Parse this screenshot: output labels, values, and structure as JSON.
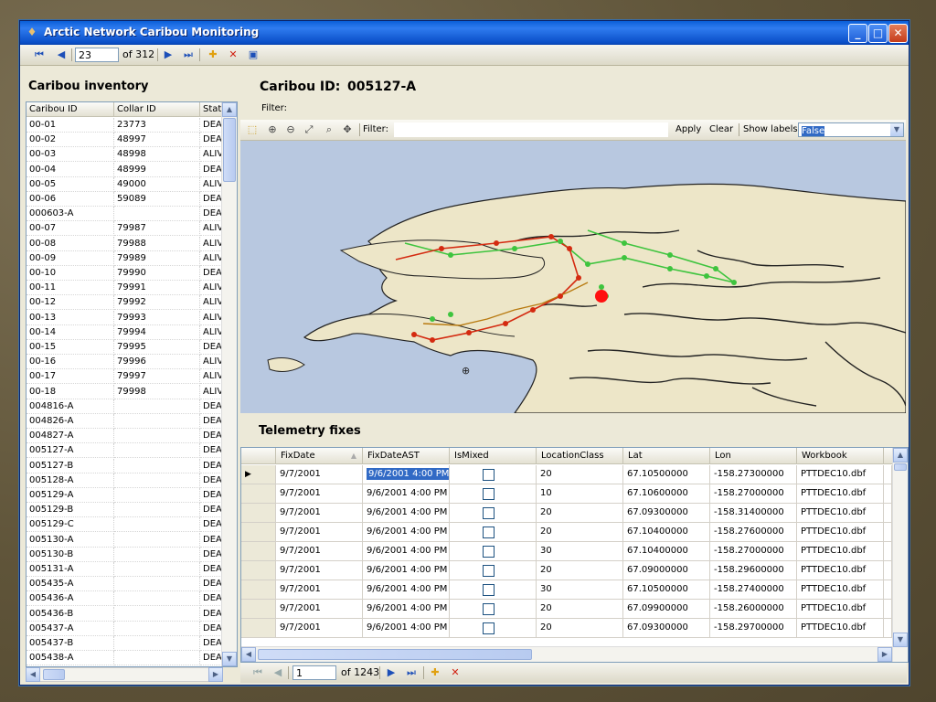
{
  "window": {
    "title": "Arctic Network Caribou Monitoring"
  },
  "top_nav": {
    "current": "23",
    "of_label": "of 312"
  },
  "left": {
    "title": "Caribou inventory",
    "columns": [
      "Caribou ID",
      "Collar ID",
      "Stat"
    ],
    "rows": [
      [
        "00-01",
        "23773",
        "DEA"
      ],
      [
        "00-02",
        "48997",
        "DEA"
      ],
      [
        "00-03",
        "48998",
        "ALIV"
      ],
      [
        "00-04",
        "48999",
        "DEA"
      ],
      [
        "00-05",
        "49000",
        "ALIV"
      ],
      [
        "00-06",
        "59089",
        "DEA"
      ],
      [
        "000603-A",
        "",
        "DEA"
      ],
      [
        "00-07",
        "79987",
        "ALIV"
      ],
      [
        "00-08",
        "79988",
        "ALIV"
      ],
      [
        "00-09",
        "79989",
        "ALIV"
      ],
      [
        "00-10",
        "79990",
        "DEA"
      ],
      [
        "00-11",
        "79991",
        "ALIV"
      ],
      [
        "00-12",
        "79992",
        "ALIV"
      ],
      [
        "00-13",
        "79993",
        "ALIV"
      ],
      [
        "00-14",
        "79994",
        "ALIV"
      ],
      [
        "00-15",
        "79995",
        "DEA"
      ],
      [
        "00-16",
        "79996",
        "ALIV"
      ],
      [
        "00-17",
        "79997",
        "ALIV"
      ],
      [
        "00-18",
        "79998",
        "ALIV"
      ],
      [
        "004816-A",
        "",
        "DEA"
      ],
      [
        "004826-A",
        "",
        "DEA"
      ],
      [
        "004827-A",
        "",
        "DEA"
      ],
      [
        "005127-A",
        "",
        "DEA"
      ],
      [
        "005127-B",
        "",
        "DEA"
      ],
      [
        "005128-A",
        "",
        "DEA"
      ],
      [
        "005129-A",
        "",
        "DEA"
      ],
      [
        "005129-B",
        "",
        "DEA"
      ],
      [
        "005129-C",
        "",
        "DEA"
      ],
      [
        "005130-A",
        "",
        "DEA"
      ],
      [
        "005130-B",
        "",
        "DEA"
      ],
      [
        "005131-A",
        "",
        "DEA"
      ],
      [
        "005435-A",
        "",
        "DEA"
      ],
      [
        "005436-A",
        "",
        "DEA"
      ],
      [
        "005436-B",
        "",
        "DEA"
      ],
      [
        "005437-A",
        "",
        "DEA"
      ],
      [
        "005437-B",
        "",
        "DEA"
      ],
      [
        "005438-A",
        "",
        "DEA"
      ]
    ]
  },
  "detail": {
    "caribou_id_label": "Caribou ID:",
    "caribou_id": "005127-A",
    "filter_label": "Filter:"
  },
  "map_toolbar": {
    "filter_label": "Filter:",
    "apply": "Apply",
    "clear": "Clear",
    "show_labels": "Show labels",
    "show_labels_value": "False"
  },
  "telemetry": {
    "title": "Telemetry fixes",
    "columns": [
      "FixDate",
      "FixDateAST",
      "IsMixed",
      "LocationClass",
      "Lat",
      "Lon",
      "Workbook"
    ],
    "rows": [
      [
        "9/7/2001",
        "9/6/2001 4:00 PM",
        "",
        "20",
        "67.10500000",
        "-158.27300000",
        "PTTDEC10.dbf"
      ],
      [
        "9/7/2001",
        "9/6/2001 4:00 PM",
        "",
        "10",
        "67.10600000",
        "-158.27000000",
        "PTTDEC10.dbf"
      ],
      [
        "9/7/2001",
        "9/6/2001 4:00 PM",
        "",
        "20",
        "67.09300000",
        "-158.31400000",
        "PTTDEC10.dbf"
      ],
      [
        "9/7/2001",
        "9/6/2001 4:00 PM",
        "",
        "20",
        "67.10400000",
        "-158.27600000",
        "PTTDEC10.dbf"
      ],
      [
        "9/7/2001",
        "9/6/2001 4:00 PM",
        "",
        "30",
        "67.10400000",
        "-158.27000000",
        "PTTDEC10.dbf"
      ],
      [
        "9/7/2001",
        "9/6/2001 4:00 PM",
        "",
        "20",
        "67.09000000",
        "-158.29600000",
        "PTTDEC10.dbf"
      ],
      [
        "9/7/2001",
        "9/6/2001 4:00 PM",
        "",
        "30",
        "67.10500000",
        "-158.27400000",
        "PTTDEC10.dbf"
      ],
      [
        "9/7/2001",
        "9/6/2001 4:00 PM",
        "",
        "20",
        "67.09900000",
        "-158.26000000",
        "PTTDEC10.dbf"
      ],
      [
        "9/7/2001",
        "9/6/2001 4:00 PM",
        "",
        "20",
        "67.09300000",
        "-158.29700000",
        "PTTDEC10.dbf"
      ]
    ]
  },
  "bottom_nav": {
    "current": "1",
    "of_label": "of 1243"
  },
  "colors": {
    "titlebar": "#0a5fd8",
    "selection": "#316ac5",
    "track_green": "#3ec43e",
    "track_red": "#d42a10",
    "land": "#ede6c8",
    "water": "#b8c8e0"
  }
}
